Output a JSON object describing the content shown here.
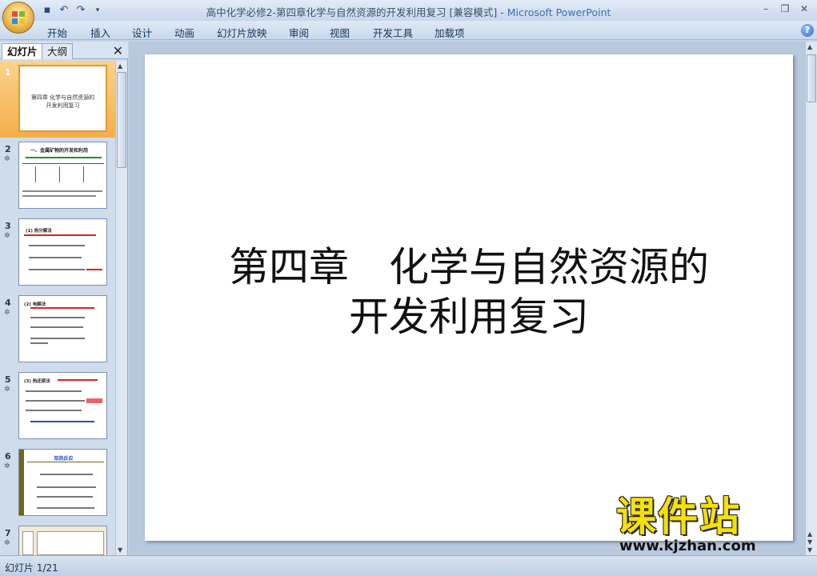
{
  "window": {
    "title": "高中化学必修2-第四章化学与自然资源的开发利用复习 [兼容模式] - ",
    "app_name": "Microsoft PowerPoint"
  },
  "ribbon": {
    "tabs": [
      "开始",
      "插入",
      "设计",
      "动画",
      "幻灯片放映",
      "审阅",
      "视图",
      "开发工具",
      "加载项"
    ]
  },
  "panel": {
    "tab_slides": "幻灯片",
    "tab_outline": "大纲"
  },
  "thumbnails": [
    {
      "num": "1",
      "text": "第四章   化学与自然资源的\n开发利用复习"
    },
    {
      "num": "2",
      "heading": "一、金属矿物的开发和利用"
    },
    {
      "num": "3",
      "heading": "(1) 热分解法"
    },
    {
      "num": "4",
      "heading": "(2) 电解法"
    },
    {
      "num": "5",
      "heading": "(3) 热还原法"
    },
    {
      "num": "6",
      "heading": "铝热反应"
    },
    {
      "num": "7",
      "heading": ""
    }
  ],
  "slide": {
    "title_line1": "第四章　化学与自然资源的",
    "title_line2": "开发利用复习"
  },
  "watermark": {
    "title": "课件站",
    "url": "www.kjzhan.com"
  },
  "status": {
    "slide_counter": "幻灯片 1/21"
  }
}
